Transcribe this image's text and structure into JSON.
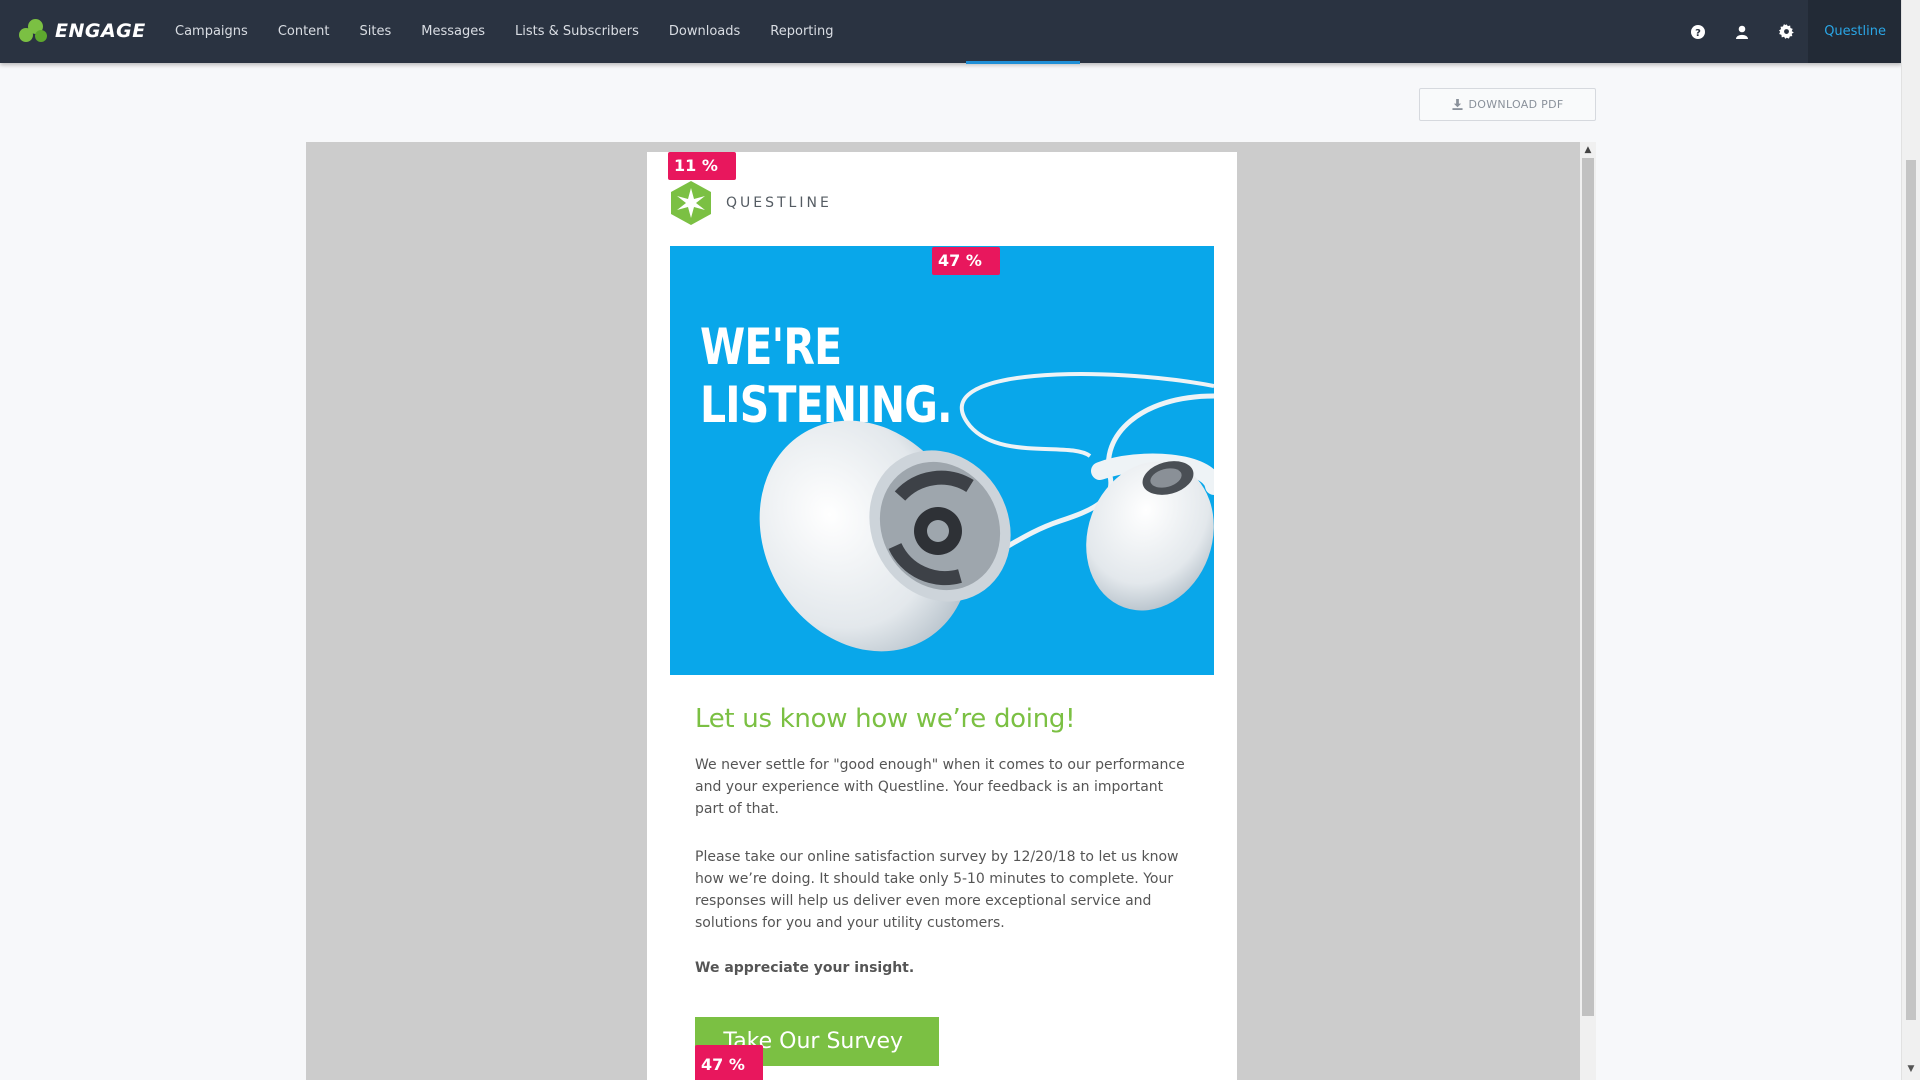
{
  "app": {
    "brand": "ENGAGE"
  },
  "nav": {
    "items": [
      "Campaigns",
      "Content",
      "Sites",
      "Messages",
      "Lists & Subscribers",
      "Downloads",
      "Reporting"
    ],
    "org_label": "Questline",
    "icons": [
      "help-icon",
      "user-icon",
      "settings-gear-icon"
    ]
  },
  "toolbar": {
    "download_label": "DOWNLOAD PDF"
  },
  "email": {
    "logo_text": "QUESTLINE",
    "hero_line1": "WE'RE",
    "hero_line2": "LISTENING.",
    "heading": "Let us know how we’re doing!",
    "paragraph1": "We never settle for \"good enough\" when it comes to our performance and your experience with Questline. Your feedback is an important part of that.",
    "paragraph2": "Please take our online satisfaction survey by 12/20/18 to let us know how we’re doing. It should take only 5-10 minutes to complete. Your responses will help us deliver even more exceptional service and solutions for you and your utility customers.",
    "closing": "We appreciate your insight.",
    "cta_label": "Take Our Survey"
  },
  "click_badges": {
    "logo": "11 %",
    "hero": "47 %",
    "cta": "47 %"
  },
  "colors": {
    "nav_bg": "#2a3341",
    "accent_green": "#7bc043",
    "hero_blue": "#09a7ea",
    "badge_pink": "#e8175d",
    "link_blue": "#2aa6e6"
  }
}
